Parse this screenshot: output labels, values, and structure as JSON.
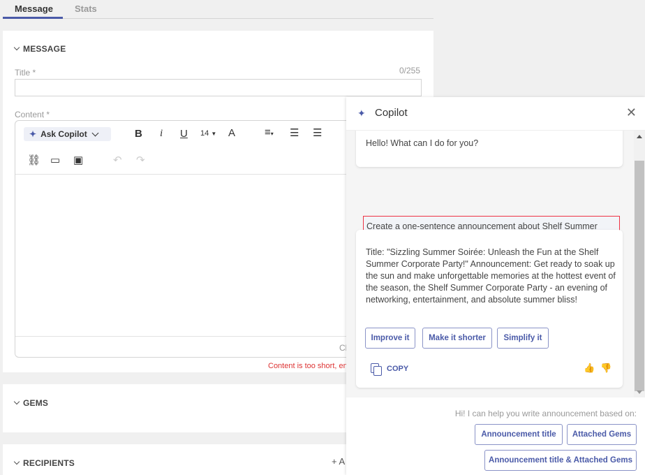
{
  "tabs": {
    "message": "Message",
    "stats": "Stats"
  },
  "message_section": {
    "heading": "MESSAGE",
    "title_label": "Title *",
    "title_counter": "0/255",
    "title_value": "",
    "content_label": "Content *",
    "ask_copilot": "Ask Copilot",
    "font_size": "14",
    "char_counter_partial": "Ch",
    "error_partial": "Content is too short, en"
  },
  "gems_section": {
    "heading": "GEMS"
  },
  "recipients_section": {
    "heading": "RECIPIENTS",
    "add_partial": "+ A"
  },
  "copilot": {
    "title": "Copilot",
    "greeting": "Hello! What can I do for you?",
    "user_prompt": "Create a one-sentence announcement about Shelf Summer Corporate Party and create a title for it.",
    "response": "Title: \"Sizzling Summer Soirée: Unleash the Fun at the Shelf Summer Corporate Party!\" Announcement: Get ready to soak up the sun and make unforgettable memories at the hottest event of the season, the Shelf Summer Corporate Party - an evening of networking, entertainment, and absolute summer bliss!",
    "actions": [
      "Improve it",
      "Make it shorter",
      "Simplify it"
    ],
    "copy_label": "COPY",
    "help_text": "Hi! I can help you write announcement based on:",
    "suggestions": [
      "Announcement title",
      "Attached Gems",
      "Announcement title & Attached Gems"
    ]
  },
  "colors": {
    "accent": "#4a5aa8",
    "error": "#dd3333",
    "highlight_border": "#ee3344"
  }
}
